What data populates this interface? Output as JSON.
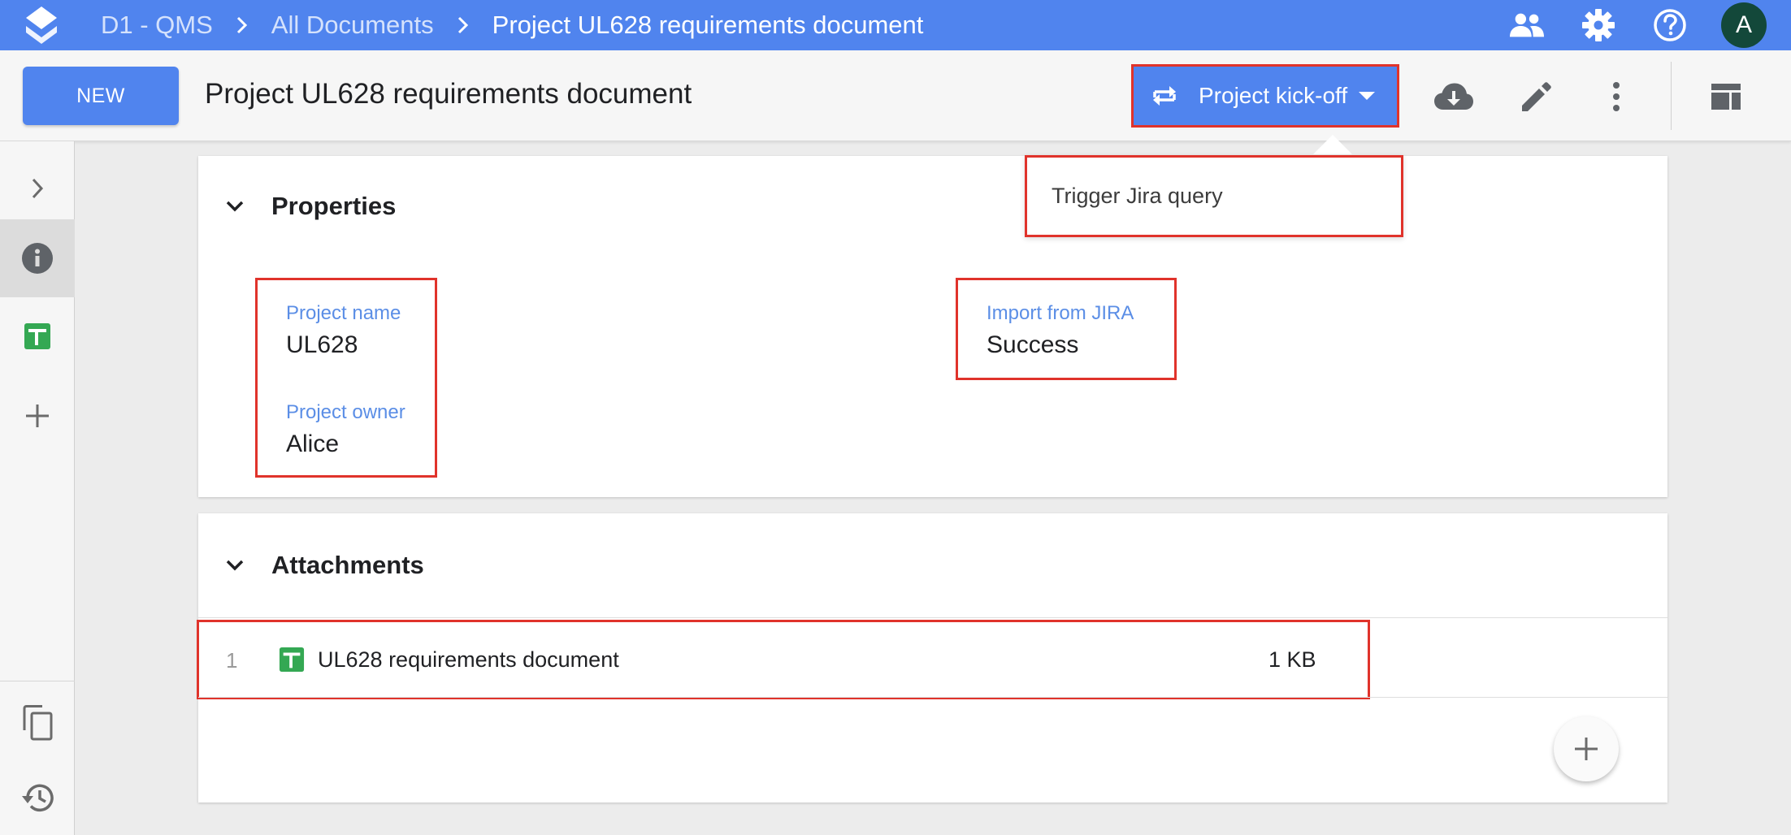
{
  "header": {
    "breadcrumbs": [
      "D1 - QMS",
      "All Documents",
      "Project UL628 requirements document"
    ],
    "icons": [
      "app-logo-icon",
      "people-icon",
      "gear-icon",
      "help-icon"
    ],
    "avatar_initial": "A"
  },
  "toolbar": {
    "new_label": "NEW",
    "document_title": "Project UL628 requirements document",
    "workflow_state": "Project kick-off",
    "icons": [
      "cloud-download-icon",
      "edit-icon",
      "more-vert-icon",
      "layout-icon"
    ]
  },
  "workflow_menu": {
    "items": [
      {
        "label": "Trigger Jira query"
      }
    ]
  },
  "sidebar": {
    "items": [
      "expand-icon",
      "info-icon",
      "sheet-icon",
      "add-icon",
      "copy-icon",
      "history-icon"
    ],
    "active": "info-icon"
  },
  "properties": {
    "heading": "Properties",
    "fields": [
      {
        "label": "Project name",
        "value": "UL628"
      },
      {
        "label": "Project owner",
        "value": "Alice"
      },
      {
        "label": "Import from JIRA",
        "value": "Success"
      }
    ]
  },
  "attachments": {
    "heading": "Attachments",
    "rows": [
      {
        "index": "1",
        "name": "UL628 requirements document",
        "size": "1 KB"
      }
    ]
  },
  "colors": {
    "brand_blue": "#5084ee",
    "highlight_red": "#e0332b",
    "label_blue": "#5b8ee6",
    "sheet_green": "#34a853",
    "avatar_green": "#13483a"
  }
}
